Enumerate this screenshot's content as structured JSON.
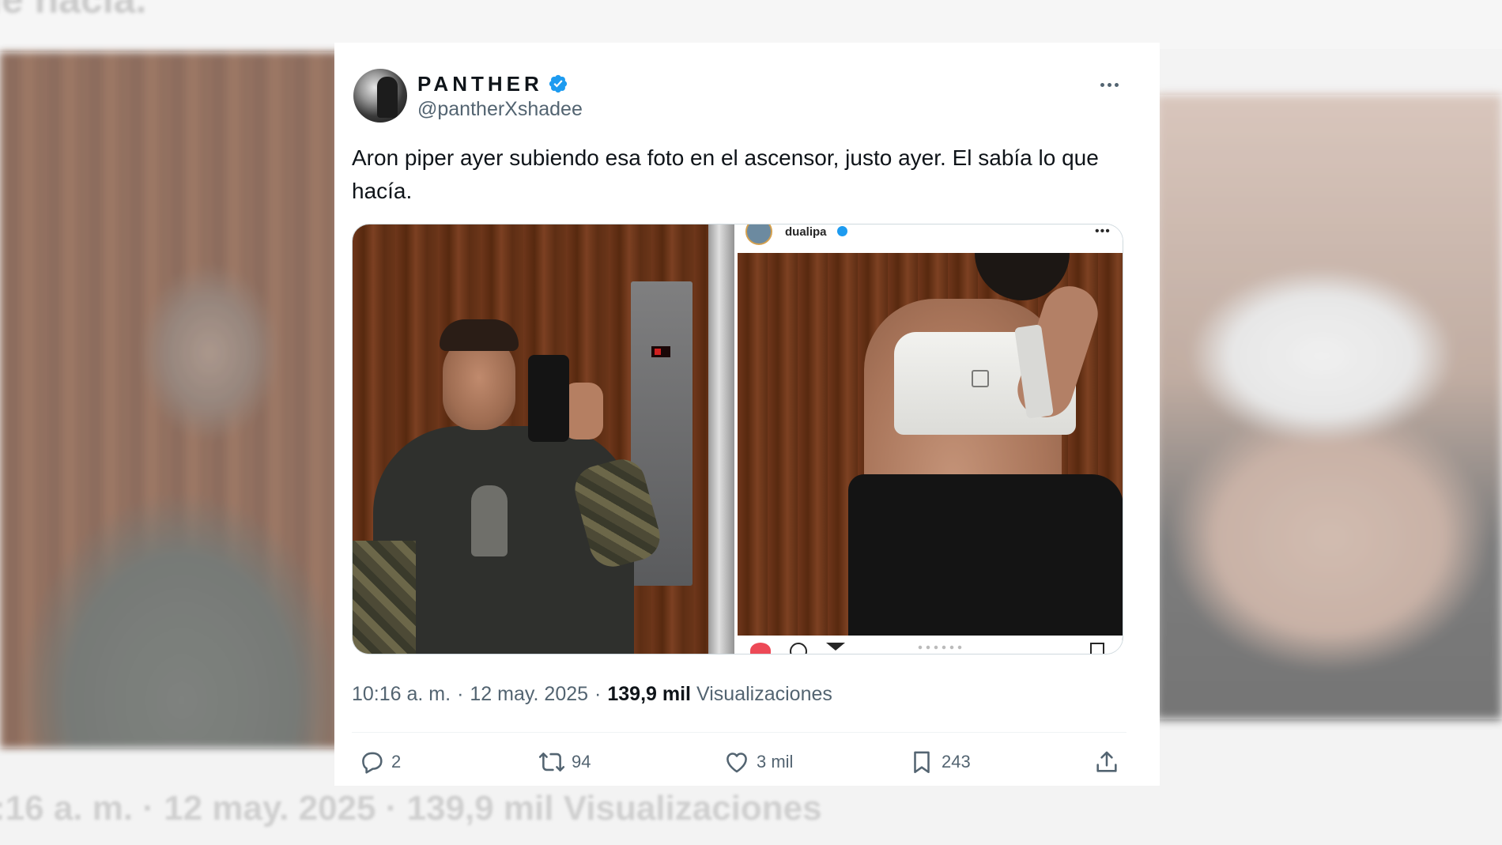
{
  "background": {
    "top_text": "le hacía.",
    "bottom_text": ":16 a. m. · 12 may. 2025 · 139,9 mil Visualizaciones"
  },
  "tweet": {
    "display_name": "PANTHER",
    "handle": "@pantherXshadee",
    "verified": true,
    "text": "Aron piper ayer subiendo esa foto en el ascensor, justo ayer. El sabía lo que hacía.",
    "media": {
      "left_photo": "elevator-selfie",
      "right_photo": {
        "type": "instagram-screenshot",
        "username": "dualipa",
        "verified": true
      }
    },
    "time": "10:16 a. m.",
    "date": "12 may. 2025",
    "views_count": "139,9 mil",
    "views_label": "Visualizaciones",
    "actions": {
      "replies": "2",
      "reposts": "94",
      "likes": "3 mil",
      "bookmarks": "243"
    }
  },
  "colors": {
    "verified_blue": "#1d9bf0",
    "text_primary": "#0f1419",
    "text_secondary": "#536471",
    "card_bg": "#ffffff"
  },
  "icons": [
    "verified-badge-icon",
    "more-options-icon",
    "reply-icon",
    "repost-icon",
    "like-icon",
    "bookmark-icon",
    "share-icon"
  ]
}
